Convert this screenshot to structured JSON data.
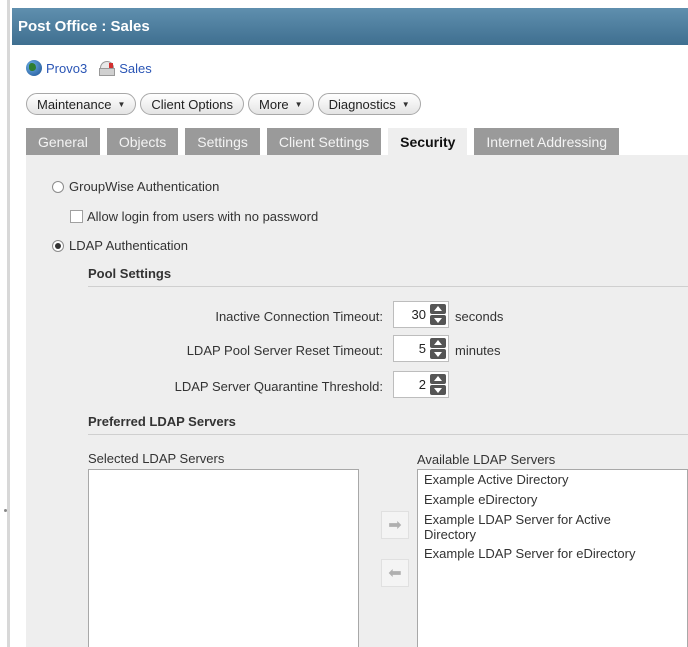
{
  "window": {
    "title": "Post Office : Sales"
  },
  "breadcrumb": [
    {
      "label": "Provo3",
      "icon": "globe-icon"
    },
    {
      "label": "Sales",
      "icon": "post-office-icon"
    }
  ],
  "menus": [
    {
      "label": "Maintenance",
      "dropdown": true
    },
    {
      "label": "Client Options",
      "dropdown": false
    },
    {
      "label": "More",
      "dropdown": true
    },
    {
      "label": "Diagnostics",
      "dropdown": true
    }
  ],
  "tabs": [
    {
      "label": "General",
      "active": false
    },
    {
      "label": "Objects",
      "active": false
    },
    {
      "label": "Settings",
      "active": false
    },
    {
      "label": "Client Settings",
      "active": false
    },
    {
      "label": "Security",
      "active": true
    },
    {
      "label": "Internet Addressing",
      "active": false
    }
  ],
  "auth": {
    "groupwise_label": "GroupWise Authentication",
    "groupwise_selected": false,
    "allow_no_password_label": "Allow login from users with no password",
    "allow_no_password_checked": false,
    "ldap_label": "LDAP Authentication",
    "ldap_selected": true
  },
  "pool": {
    "title": "Pool Settings",
    "inactive_timeout": {
      "label": "Inactive Connection Timeout:",
      "value": "30",
      "unit": "seconds"
    },
    "reset_timeout": {
      "label": "LDAP Pool Server Reset Timeout:",
      "value": "5",
      "unit": "minutes"
    },
    "quarantine": {
      "label": "LDAP Server Quarantine Threshold:",
      "value": "2",
      "unit": ""
    }
  },
  "servers": {
    "title": "Preferred LDAP Servers",
    "selected_label": "Selected LDAP Servers",
    "selected": [],
    "available_label": "Available LDAP Servers",
    "available": [
      "Example Active Directory",
      "Example eDirectory",
      "Example LDAP Server for Active Directory",
      "Example LDAP Server for eDirectory"
    ],
    "add_glyph": "➡",
    "remove_glyph": "⬅"
  },
  "colors": {
    "titlebar": "#4a7a9b",
    "tab_inactive": "#9a9a9a",
    "tab_active": "#eeeeee",
    "link": "#2a55b5"
  }
}
